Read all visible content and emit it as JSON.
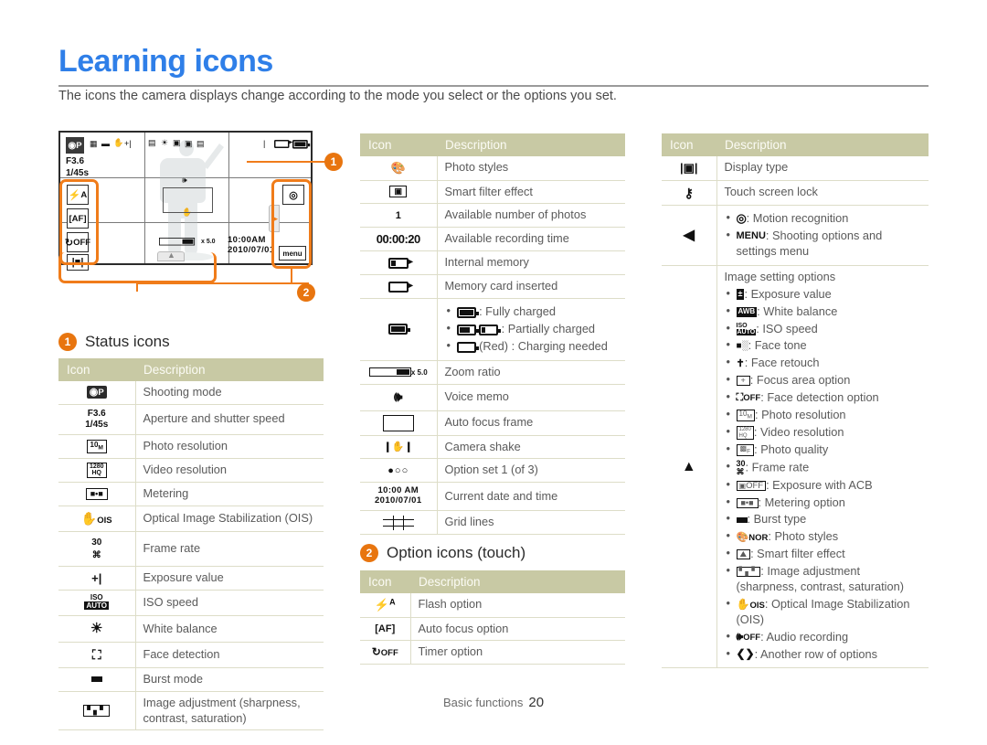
{
  "page": {
    "title": "Learning icons",
    "intro": "The icons the camera displays change according to the mode you select or the options you set.",
    "footer_label": "Basic functions",
    "footer_page": "20",
    "accent_blue": "#2f7fe8",
    "accent_orange": "#e8750f",
    "table_header_bg": "#c8c9a4"
  },
  "diagram": {
    "name": "camera-screen-preview",
    "shooting_mode": "P",
    "aperture": "F3.6",
    "shutter": "1/45s",
    "zoom_ratio": "x 5.0",
    "time": "10:00AM",
    "date": "2010/07/01",
    "menu_label": "menu",
    "left_buttons": [
      "flash-auto",
      "auto-focus",
      "timer-off",
      "display-type"
    ],
    "right_buttons": [
      "motion-recognition",
      "menu"
    ],
    "callout_1": "1",
    "callout_2": "2"
  },
  "sections": {
    "status": {
      "badge": "1",
      "title": "Status icons"
    },
    "option": {
      "badge": "2",
      "title": "Option icons (touch)"
    }
  },
  "table_headers": {
    "icon": "Icon",
    "description": "Description"
  },
  "status_icons": [
    {
      "icon": "shooting-mode",
      "desc": "Shooting mode"
    },
    {
      "icon": "aperture-shutter",
      "icon_text1": "F3.6",
      "icon_text2": "1/45s",
      "desc": "Aperture and shutter speed"
    },
    {
      "icon": "photo-resolution",
      "desc": "Photo resolution"
    },
    {
      "icon": "video-resolution",
      "desc": "Video resolution"
    },
    {
      "icon": "metering",
      "desc": "Metering"
    },
    {
      "icon": "ois",
      "desc": "Optical Image Stabilization (OIS)"
    },
    {
      "icon": "frame-rate",
      "desc": "Frame rate"
    },
    {
      "icon": "exposure-value",
      "desc": "Exposure value"
    },
    {
      "icon": "iso-speed",
      "desc": "ISO speed"
    },
    {
      "icon": "white-balance",
      "desc": "White balance"
    },
    {
      "icon": "face-detection",
      "desc": "Face detection"
    },
    {
      "icon": "burst-mode",
      "desc": "Burst mode"
    },
    {
      "icon": "image-adjustment",
      "desc": "Image adjustment (sharpness, contrast, saturation)"
    }
  ],
  "middle_icons": [
    {
      "icon": "photo-styles",
      "desc": "Photo styles"
    },
    {
      "icon": "smart-filter",
      "desc": "Smart filter effect"
    },
    {
      "icon": "available-photos",
      "icon_text": "1",
      "desc": "Available number of photos"
    },
    {
      "icon": "recording-time",
      "icon_text": "00:00:20",
      "desc": "Available recording time"
    },
    {
      "icon": "internal-memory",
      "desc": "Internal memory"
    },
    {
      "icon": "memory-card",
      "desc": "Memory card inserted"
    },
    {
      "icon": "battery",
      "desc_list": [
        {
          "glyph": "battery-full",
          "text": ": Fully charged"
        },
        {
          "glyph": "battery-partial",
          "text": ": Partially charged"
        },
        {
          "glyph": "battery-empty",
          "text": "(Red) : Charging needed"
        }
      ]
    },
    {
      "icon": "zoom-ratio",
      "icon_text": "x 5.0",
      "desc": "Zoom ratio"
    },
    {
      "icon": "voice-memo",
      "desc": "Voice memo"
    },
    {
      "icon": "auto-focus-frame",
      "desc": "Auto focus frame"
    },
    {
      "icon": "camera-shake",
      "desc": "Camera shake"
    },
    {
      "icon": "option-set",
      "icon_text": "●○○",
      "desc": "Option set 1  (of 3)"
    },
    {
      "icon": "current-date-time",
      "icon_text1": "10:00 AM",
      "icon_text2": "2010/07/01",
      "desc": "Current date and time"
    },
    {
      "icon": "grid-lines",
      "desc": "Grid lines"
    }
  ],
  "option_icons": [
    {
      "icon": "flash-option",
      "desc": "Flash option"
    },
    {
      "icon": "auto-focus-option",
      "desc": "Auto focus option"
    },
    {
      "icon": "timer-option",
      "desc": "Timer option"
    }
  ],
  "right_icons": [
    {
      "icon": "display-type",
      "desc": "Display type"
    },
    {
      "icon": "touch-screen-lock",
      "desc": "Touch screen lock"
    },
    {
      "icon": "left-arrow",
      "desc_list": [
        {
          "glyph": "motion-recognition",
          "text": ": Motion recognition"
        },
        {
          "glyph": "menu",
          "text": ": Shooting options and settings menu"
        }
      ]
    },
    {
      "icon": "up-arrow",
      "heading": "Image setting options",
      "desc_list": [
        {
          "glyph": "exposure-value",
          "text": ": Exposure value"
        },
        {
          "glyph": "white-balance",
          "text": ": White balance"
        },
        {
          "glyph": "iso-speed",
          "text": ": ISO speed"
        },
        {
          "glyph": "face-tone",
          "text": ": Face tone"
        },
        {
          "glyph": "face-retouch",
          "text": ": Face retouch"
        },
        {
          "glyph": "focus-area",
          "text": ": Focus area option"
        },
        {
          "glyph": "face-detection-option",
          "text": ": Face detection option"
        },
        {
          "glyph": "photo-resolution",
          "text": ": Photo resolution"
        },
        {
          "glyph": "video-resolution",
          "text": ": Video resolution"
        },
        {
          "glyph": "photo-quality",
          "text": ": Photo quality"
        },
        {
          "glyph": "frame-rate",
          "text": ": Frame rate"
        },
        {
          "glyph": "exposure-acb",
          "text": ": Exposure with ACB"
        },
        {
          "glyph": "metering-option",
          "text": ": Metering option"
        },
        {
          "glyph": "burst-type",
          "text": ": Burst type"
        },
        {
          "glyph": "photo-styles",
          "text": ": Photo styles"
        },
        {
          "glyph": "smart-filter",
          "text": ": Smart filter effect"
        },
        {
          "glyph": "image-adjustment",
          "text": ": Image adjustment (sharpness, contrast, saturation)"
        },
        {
          "glyph": "ois",
          "text": ": Optical Image Stabilization (OIS)"
        },
        {
          "glyph": "audio-recording",
          "text": ": Audio recording"
        },
        {
          "glyph": "another-row",
          "text": ": Another row of options"
        }
      ]
    }
  ]
}
